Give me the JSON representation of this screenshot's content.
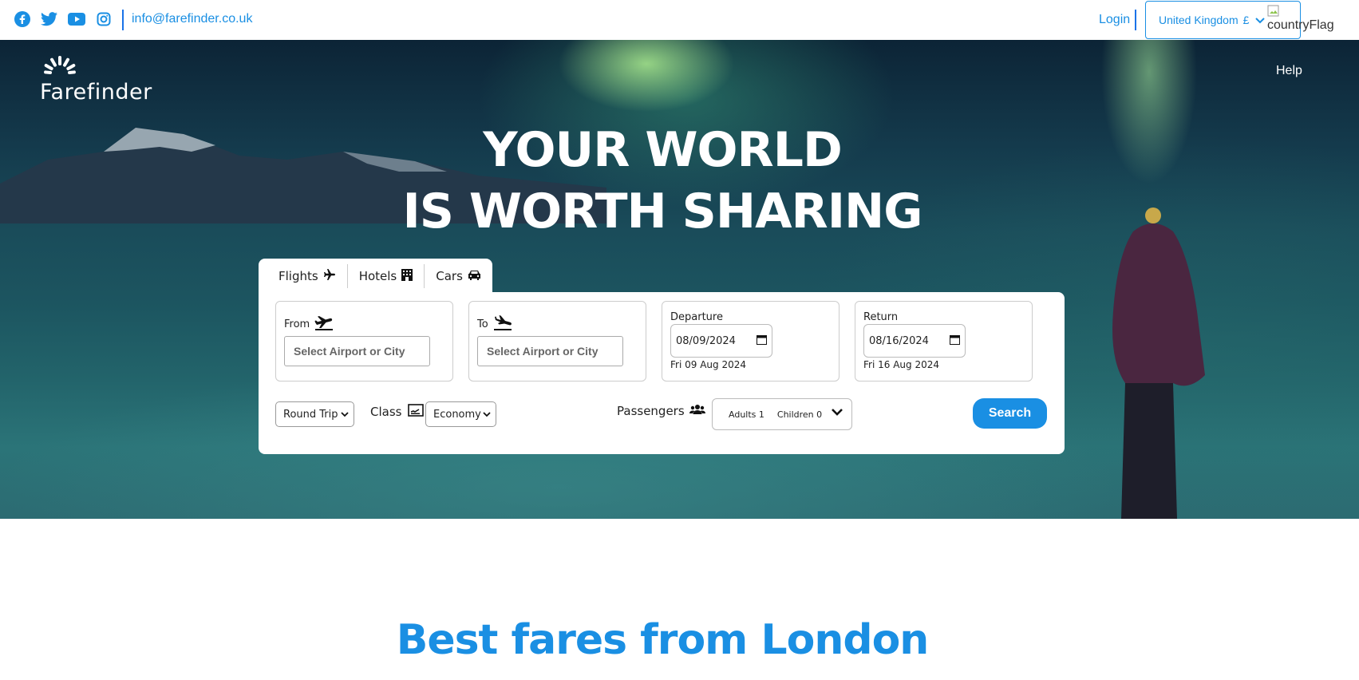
{
  "topbar": {
    "social": [
      {
        "name": "facebook-icon"
      },
      {
        "name": "twitter-icon"
      },
      {
        "name": "youtube-icon"
      },
      {
        "name": "instagram-icon"
      }
    ],
    "email": "info@farefinder.co.uk",
    "login_label": "Login",
    "country_label": "United Kingdom",
    "currency_symbol": "£",
    "flag_alt": "countryFlag"
  },
  "nav": {
    "brand": "Farefinder",
    "help_label": "Help"
  },
  "hero": {
    "line1": "YOUR WORLD",
    "line2": "IS WORTH SHARING"
  },
  "search": {
    "tabs": [
      {
        "label": "Flights",
        "icon": "plane-icon"
      },
      {
        "label": "Hotels",
        "icon": "building-icon"
      },
      {
        "label": "Cars",
        "icon": "car-icon"
      }
    ],
    "from_label": "From",
    "to_label": "To",
    "city_placeholder": "Select Airport or City",
    "departure_label": "Departure",
    "departure_value": "08/09/2024",
    "departure_text": "Fri 09 Aug 2024",
    "return_label": "Return",
    "return_value": "08/16/2024",
    "return_text": "Fri 16 Aug 2024",
    "trip_type": "Round Trip",
    "class_label": "Class",
    "class_value": "Economy",
    "passengers_label": "Passengers",
    "adults": "Adults 1",
    "children": "Children 0",
    "search_label": "Search"
  },
  "section": {
    "title": "Best fares from London"
  },
  "colors": {
    "accent": "#1a8fe3",
    "hero_text": "#ffffff"
  }
}
